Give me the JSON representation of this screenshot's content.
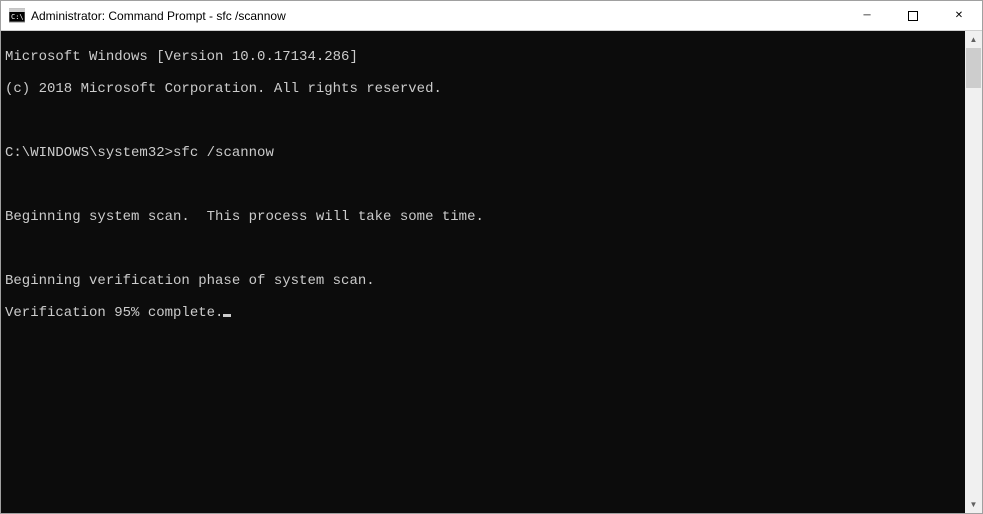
{
  "window": {
    "title": "Administrator: Command Prompt - sfc  /scannow"
  },
  "console": {
    "line1": "Microsoft Windows [Version 10.0.17134.286]",
    "line2": "(c) 2018 Microsoft Corporation. All rights reserved.",
    "blank1": "",
    "prompt_path": "C:\\WINDOWS\\system32>",
    "prompt_command": "sfc /scannow",
    "blank2": "",
    "line3": "Beginning system scan.  This process will take some time.",
    "blank3": "",
    "line4": "Beginning verification phase of system scan.",
    "line5": "Verification 95% complete."
  },
  "icons": {
    "minimize": "─",
    "close": "✕",
    "scroll_up": "▲",
    "scroll_down": "▼"
  }
}
